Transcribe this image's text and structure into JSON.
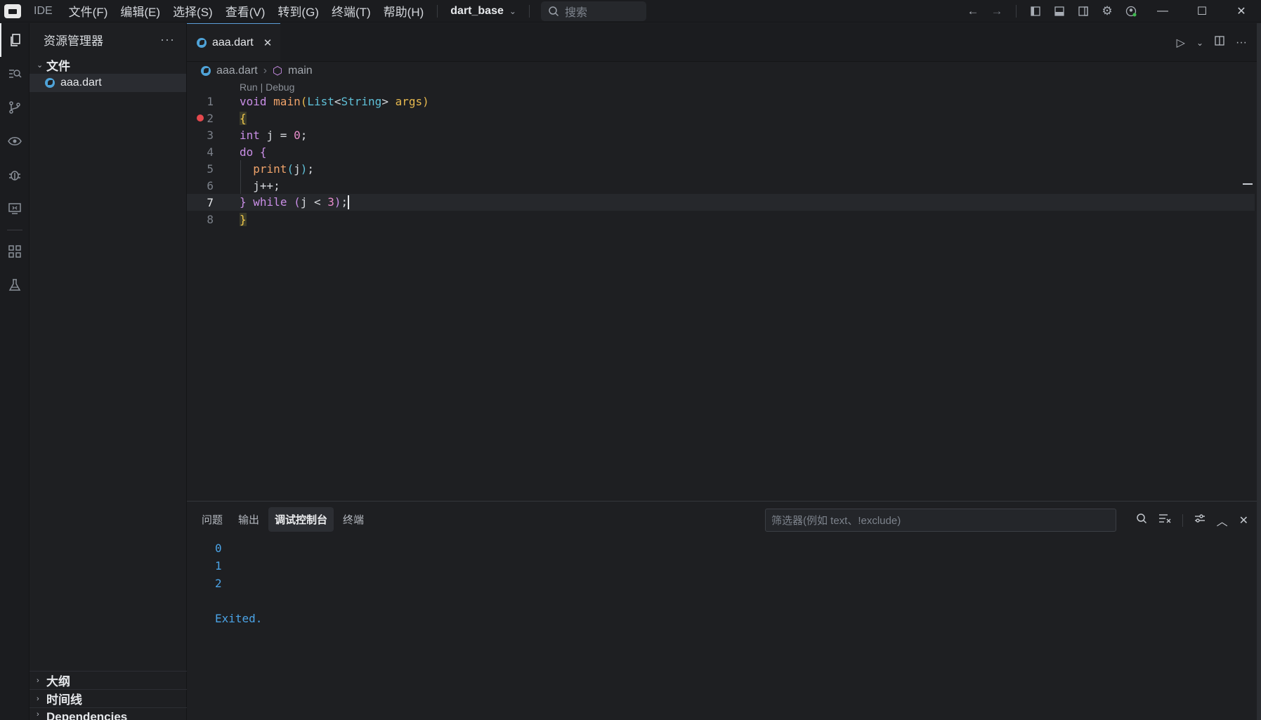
{
  "titlebar": {
    "ide_label": "IDE",
    "menus": [
      "文件(F)",
      "编辑(E)",
      "选择(S)",
      "查看(V)",
      "转到(G)",
      "终端(T)",
      "帮助(H)"
    ],
    "workspace": "dart_base",
    "search_placeholder": "搜索"
  },
  "sidebar": {
    "title": "资源管理器",
    "folder": "文件",
    "file": "aaa.dart",
    "sections": [
      "大纲",
      "时间线",
      "Dependencies"
    ]
  },
  "editor": {
    "tab_label": "aaa.dart",
    "breadcrumb": {
      "file": "aaa.dart",
      "symbol": "main"
    },
    "codelens": "Run | Debug",
    "line_numbers": [
      "1",
      "2",
      "3",
      "4",
      "5",
      "6",
      "7",
      "8"
    ],
    "current_line": 7,
    "breakpoint_line": 2
  },
  "panel": {
    "tabs": [
      "问题",
      "输出",
      "调试控制台",
      "终端"
    ],
    "active_tab": "调试控制台",
    "filter_placeholder": "筛选器(例如 text、!exclude)",
    "console_output": [
      "0",
      "1",
      "2",
      "",
      "Exited."
    ]
  },
  "colors": {
    "background": "#1e1f22",
    "accent": "#5a9bd5",
    "console_text": "#4ba3e6",
    "breakpoint": "#e5484d"
  }
}
